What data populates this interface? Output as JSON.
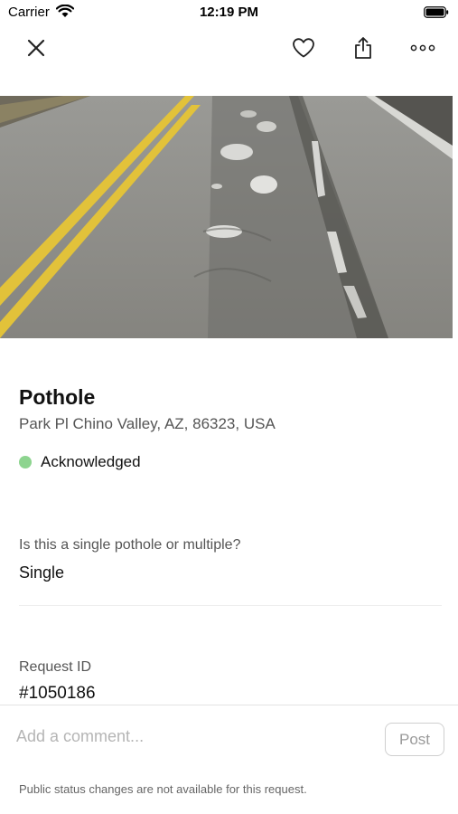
{
  "status_bar": {
    "carrier": "Carrier",
    "time": "12:19 PM"
  },
  "toolbar": {
    "icons": [
      "close-icon",
      "heart-icon",
      "share-icon",
      "more-icon"
    ]
  },
  "request": {
    "title": "Pothole",
    "address": "Park Pl Chino Valley, AZ, 86323, USA",
    "status": "Acknowledged",
    "status_color": "#8dd48f",
    "question_label": "Is this a single pothole or multiple?",
    "question_answer": "Single",
    "id_label": "Request ID",
    "id_value": "#1050186"
  },
  "comment": {
    "placeholder": "Add a comment...",
    "post_label": "Post",
    "note": "Public status changes are not available for this request."
  }
}
